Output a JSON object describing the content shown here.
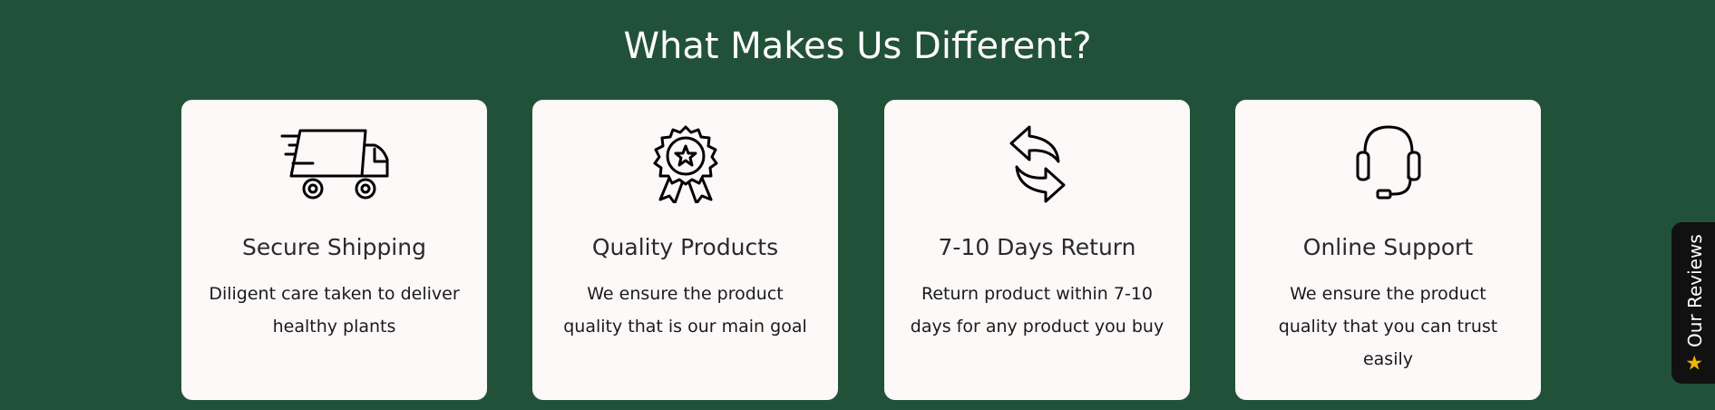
{
  "section": {
    "title": "What Makes Us Different?"
  },
  "cards": [
    {
      "icon": "delivery-truck-icon",
      "title": "Secure Shipping",
      "description": "Diligent care taken to deliver\nhealthy  plants"
    },
    {
      "icon": "award-badge-icon",
      "title": "Quality Products",
      "description": "We ensure the product\nquality that is our main goal"
    },
    {
      "icon": "return-arrows-icon",
      "title": "7-10 Days Return",
      "description": "Return product within 7-10\ndays for any product you buy"
    },
    {
      "icon": "headset-icon",
      "title": "Online Support",
      "description": "We ensure the product\nquality that you can trust\neasily"
    }
  ],
  "reviews_tab": {
    "label": "Our Reviews",
    "icon": "star-icon"
  },
  "colors": {
    "background": "#22513a",
    "card": "#fcf9f8",
    "tab": "#111111",
    "star": "#f4b400"
  }
}
